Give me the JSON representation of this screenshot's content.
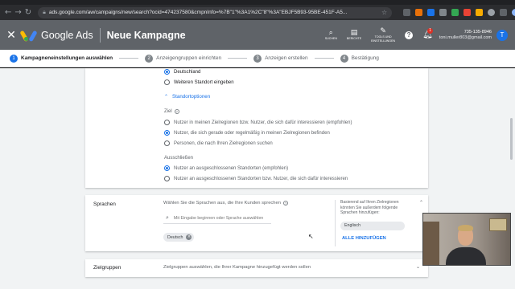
{
  "browser": {
    "url": "ads.google.com/aw/campaigns/new/search?ocid=474237580&cmpnInfo=%7B\"1\"%3A1%2C\"8\"%3A\"EBJF5B93-95BE-451F-A5...",
    "back_icon": "arrow-left-icon",
    "forward_icon": "arrow-right-icon",
    "reload_icon": "reload-icon"
  },
  "header": {
    "brand": "Google Ads",
    "title": "Neue Kampagne",
    "tools": [
      {
        "label": "SUCHEN",
        "icon": "search-icon"
      },
      {
        "label": "BERICHTE",
        "icon": "reports-icon"
      },
      {
        "label": "TOOLS UND EINSTELLUNGEN",
        "icon": "wrench-icon"
      }
    ],
    "notification_count": "1",
    "account_id": "735-135-8946",
    "account_email": "toni.muller803@gmail.com",
    "avatar_letter": "T"
  },
  "stepper": [
    {
      "num": "1",
      "label": "Kampagneneinstellungen auswählen",
      "active": true
    },
    {
      "num": "2",
      "label": "Anzeigengruppen einrichten",
      "active": false
    },
    {
      "num": "3",
      "label": "Anzeigen erstellen",
      "active": false
    },
    {
      "num": "4",
      "label": "Bestätigung",
      "active": false
    }
  ],
  "location": {
    "options": [
      {
        "label": "Deutschland",
        "selected": true
      },
      {
        "label": "Weiteren Standort eingeben",
        "selected": false
      }
    ],
    "options_link": "Standortoptionen",
    "target_label": "Ziel",
    "target_options": [
      {
        "label": "Nutzer in meinen Zielregionen bzw. Nutzer, die sich dafür interessieren (empfohlen)",
        "selected": false
      },
      {
        "label": "Nutzer, die sich gerade oder regelmäßig in meinen Zielregionen befinden",
        "selected": true
      },
      {
        "label": "Personen, die nach Ihren Zielregionen suchen",
        "selected": false
      }
    ],
    "exclude_label": "Ausschließen",
    "exclude_options": [
      {
        "label": "Nutzer an ausgeschlossenen Standorten (empfohlen)",
        "selected": true
      },
      {
        "label": "Nutzer an ausgeschlossenen Standorten bzw. Nutzer, die sich dafür interessieren",
        "selected": false
      }
    ]
  },
  "languages": {
    "title": "Sprachen",
    "description": "Wählen Sie die Sprachen aus, die Ihre Kunden sprechen",
    "search_placeholder": "Mit Eingabe beginnen oder Sprache auswählen",
    "selected_chip": "Deutsch",
    "suggestion_text": "Basierend auf Ihren Zielregionen könnten Sie außerdem folgende Sprachen hinzufügen:",
    "suggested_language": "Englisch",
    "add_all": "ALLE HINZUFÜGEN"
  },
  "audiences": {
    "title": "Zielgruppen",
    "description": "Zielgruppen auswählen, die Ihrer Kampagne hinzugefügt werden sollen"
  },
  "colors": {
    "header_bg": "#5f6368",
    "accent": "#1a73e8",
    "page_bg": "#f1f3f4"
  }
}
